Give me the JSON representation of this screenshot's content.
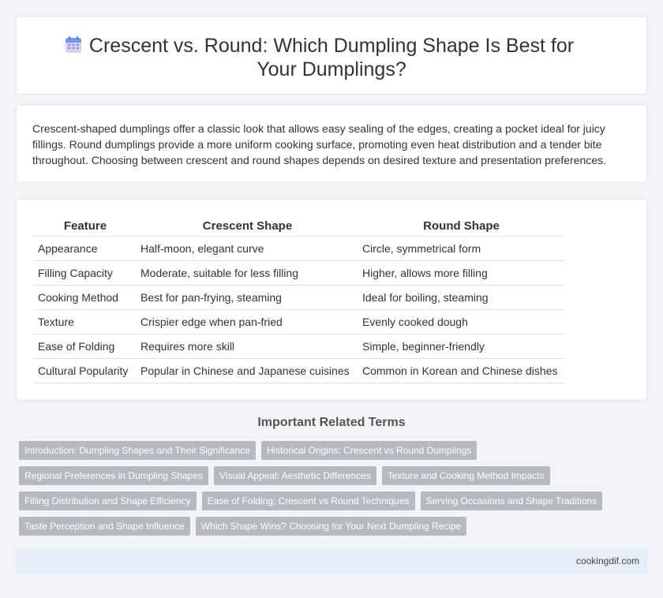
{
  "header": {
    "title": "Crescent vs. Round: Which Dumpling Shape Is Best for Your Dumplings?",
    "icon": "calendar-icon"
  },
  "intro": {
    "text": "Crescent-shaped dumplings offer a classic look that allows easy sealing of the edges, creating a pocket ideal for juicy fillings. Round dumplings provide a more uniform cooking surface, promoting even heat distribution and a tender bite throughout. Choosing between crescent and round shapes depends on desired texture and presentation preferences."
  },
  "table": {
    "headers": [
      "Feature",
      "Crescent Shape",
      "Round Shape"
    ],
    "rows": [
      [
        "Appearance",
        "Half-moon, elegant curve",
        "Circle, symmetrical form"
      ],
      [
        "Filling Capacity",
        "Moderate, suitable for less filling",
        "Higher, allows more filling"
      ],
      [
        "Cooking Method",
        "Best for pan-frying, steaming",
        "Ideal for boiling, steaming"
      ],
      [
        "Texture",
        "Crispier edge when pan-fried",
        "Evenly cooked dough"
      ],
      [
        "Ease of Folding",
        "Requires more skill",
        "Simple, beginner-friendly"
      ],
      [
        "Cultural Popularity",
        "Popular in Chinese and Japanese cuisines",
        "Common in Korean and Chinese dishes"
      ]
    ]
  },
  "related": {
    "heading": "Important Related Terms",
    "rows": [
      [
        "Introduction: Dumpling Shapes and Their Significance",
        "Historical Origins: Crescent vs Round Dumplings"
      ],
      [
        "Regional Preferences in Dumpling Shapes",
        "Visual Appeal: Aesthetic Differences",
        "Texture and Cooking Method Impacts"
      ],
      [
        "Filling Distribution and Shape Efficiency",
        "Ease of Folding: Crescent vs Round Techniques",
        "Serving Occasions and Shape Traditions"
      ],
      [
        "Taste Perception and Shape Influence",
        "Which Shape Wins? Choosing for Your Next Dumpling Recipe"
      ]
    ]
  },
  "footer": {
    "site": "cookingdif.com"
  },
  "colors": {
    "background": "#f2f4f7",
    "tag": "#b5b9c0",
    "footer": "#e8eef7",
    "icon_top": "#5b8def",
    "icon_body": "#c9b8f0"
  }
}
